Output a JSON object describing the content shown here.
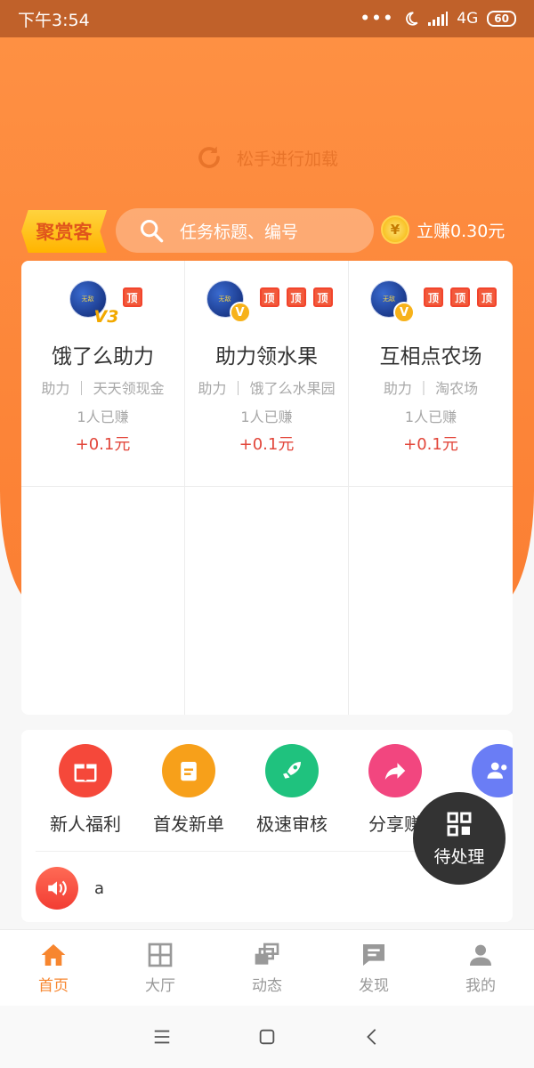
{
  "status_bar": {
    "time": "下午3:54",
    "dots": "•••",
    "network": "4G",
    "battery": "60"
  },
  "refresh": {
    "text": "松手进行加载"
  },
  "brand": {
    "label": "聚赏客"
  },
  "search": {
    "placeholder": "任务标题、编号"
  },
  "earn": {
    "coin": "¥",
    "label": "立赚0.30元"
  },
  "tasks": [
    {
      "title": "饿了么助力",
      "sub": "助力 ｜ 天天领现金",
      "count": "1人已赚",
      "reward": "+0.1元",
      "top_tags": [
        "顶"
      ],
      "level": "3",
      "avatar_text": "无敌"
    },
    {
      "title": "助力领水果",
      "sub": "助力 ｜ 饿了么水果园",
      "count": "1人已赚",
      "reward": "+0.1元",
      "top_tags": [
        "顶",
        "顶",
        "顶"
      ],
      "badge": "V",
      "avatar_text": "无敌"
    },
    {
      "title": "互相点农场",
      "sub": "助力 ｜ 淘农场",
      "count": "1人已赚",
      "reward": "+0.1元",
      "top_tags": [
        "顶",
        "顶",
        "顶"
      ],
      "badge": "V",
      "avatar_text": "无敌"
    }
  ],
  "quick": [
    {
      "label": "新人福利",
      "icon": "gift-icon",
      "color": "#f5483a"
    },
    {
      "label": "首发新单",
      "icon": "clipboard-icon",
      "color": "#f7a01a"
    },
    {
      "label": "极速审核",
      "icon": "rocket-icon",
      "color": "#1fc27e"
    },
    {
      "label": "分享赚",
      "icon": "share-icon",
      "color": "#f2467f"
    },
    {
      "label": "",
      "icon": "users-icon",
      "color": "#6a7df5"
    }
  ],
  "notice": {
    "text": "a"
  },
  "float_button": {
    "label": "待处理"
  },
  "tabs": [
    {
      "label": "首页",
      "icon": "home-icon",
      "active": true
    },
    {
      "label": "大厅",
      "icon": "grid-icon"
    },
    {
      "label": "动态",
      "icon": "layers-icon"
    },
    {
      "label": "发现",
      "icon": "message-icon"
    },
    {
      "label": "我的",
      "icon": "user-icon"
    }
  ],
  "colors": {
    "accent": "#f7862f",
    "header": "#fb7f33",
    "reward": "#e2463a"
  }
}
